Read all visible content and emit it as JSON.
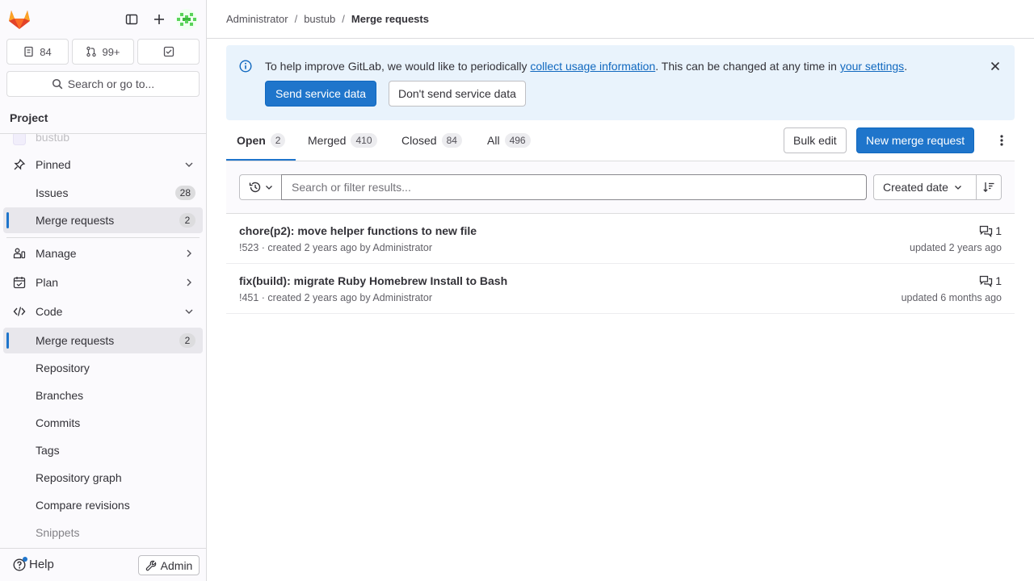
{
  "sidebar": {
    "counters": [
      {
        "icon": "issues-icon",
        "value": "84"
      },
      {
        "icon": "merge-request-icon",
        "value": "99+"
      },
      {
        "icon": "todo-icon",
        "value": ""
      }
    ],
    "search_label": "Search or go to...",
    "section_title": "Project",
    "partial_item": "bustub",
    "pinned": {
      "label": "Pinned",
      "items": [
        {
          "label": "Issues",
          "count": "28"
        },
        {
          "label": "Merge requests",
          "count": "2"
        }
      ]
    },
    "manage": "Manage",
    "plan": "Plan",
    "code": {
      "label": "Code",
      "items": [
        {
          "label": "Merge requests",
          "count": "2"
        },
        {
          "label": "Repository"
        },
        {
          "label": "Branches"
        },
        {
          "label": "Commits"
        },
        {
          "label": "Tags"
        },
        {
          "label": "Repository graph"
        },
        {
          "label": "Compare revisions"
        },
        {
          "label": "Snippets"
        }
      ]
    },
    "help": "Help",
    "admin": "Admin"
  },
  "breadcrumb": {
    "items": [
      "Administrator",
      "bustub"
    ],
    "current": "Merge requests",
    "separator": "/"
  },
  "banner": {
    "text_before": "To help improve GitLab, we would like to periodically ",
    "link1": "collect usage information",
    "text_middle": ". This can be changed at any time in ",
    "link2": "your settings",
    "text_after": ".",
    "primary_button": "Send service data",
    "secondary_button": "Don't send service data"
  },
  "tabs": [
    {
      "label": "Open",
      "count": "2"
    },
    {
      "label": "Merged",
      "count": "410"
    },
    {
      "label": "Closed",
      "count": "84"
    },
    {
      "label": "All",
      "count": "496"
    }
  ],
  "actions": {
    "bulk_edit": "Bulk edit",
    "new_mr": "New merge request"
  },
  "filter": {
    "placeholder": "Search or filter results...",
    "sort": "Created date"
  },
  "merge_requests": [
    {
      "title": "chore(p2): move helper functions to new file",
      "meta": "!523 · created 2 years ago by Administrator",
      "comments": "1",
      "updated": "updated 2 years ago"
    },
    {
      "title": "fix(build): migrate Ruby Homebrew Install to Bash",
      "meta": "!451 · created 2 years ago by Administrator",
      "comments": "1",
      "updated": "updated 6 months ago"
    }
  ],
  "colors": {
    "accent": "#1f75cb",
    "banner": "#e9f3fc",
    "sidebar": "#fbfafd"
  }
}
